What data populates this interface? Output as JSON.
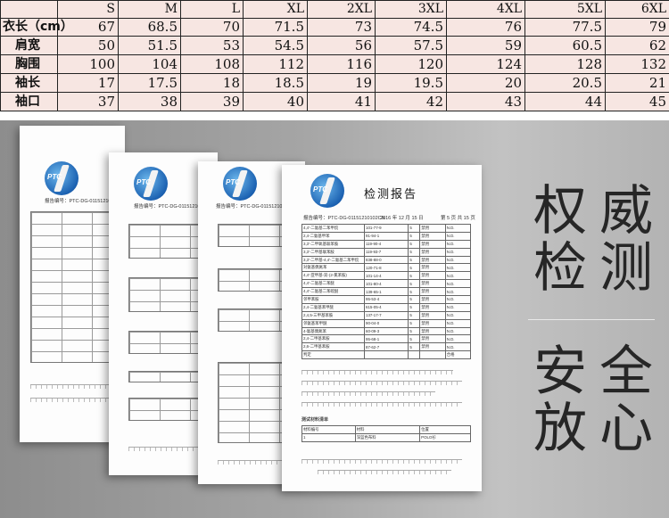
{
  "size_chart": {
    "sizes": [
      "S",
      "M",
      "L",
      "XL",
      "2XL",
      "3XL",
      "4XL",
      "5XL",
      "6XL"
    ],
    "rows": [
      {
        "label": "衣长（cm）",
        "values": [
          "67",
          "68.5",
          "70",
          "71.5",
          "73",
          "74.5",
          "76",
          "77.5",
          "79"
        ]
      },
      {
        "label": "肩宽",
        "values": [
          "50",
          "51.5",
          "53",
          "54.5",
          "56",
          "57.5",
          "59",
          "60.5",
          "62"
        ]
      },
      {
        "label": "胸围",
        "values": [
          "100",
          "104",
          "108",
          "112",
          "116",
          "120",
          "124",
          "128",
          "132"
        ]
      },
      {
        "label": "袖长",
        "values": [
          "17",
          "17.5",
          "18",
          "18.5",
          "19",
          "19.5",
          "20",
          "20.5",
          "21"
        ]
      },
      {
        "label": "袖口",
        "values": [
          "37",
          "38",
          "39",
          "40",
          "41",
          "42",
          "43",
          "44",
          "45"
        ]
      }
    ]
  },
  "banner": {
    "headline_line1": "权威",
    "headline_line2": "检测",
    "tagline_line1": "安全",
    "tagline_line2": "放心",
    "report": {
      "title": "检测报告",
      "report_no_label": "报告编号：",
      "report_no": "PTC-DG-01151210102CN",
      "date": "2016 年 12 月 15 日",
      "page": "第 5 页  共 15 页",
      "logo_text": "PTC"
    },
    "report_rows": [
      [
        "4,4'-二氨基二苯甲烷",
        "101-77-9",
        "5",
        "禁用",
        "N.D."
      ],
      [
        "2,4-二氨基甲苯",
        "91-94-1",
        "5",
        "禁用",
        "N.D."
      ],
      [
        "3,3'-二甲氧基联苯胺",
        "119-90-4",
        "5",
        "禁用",
        "N.D."
      ],
      [
        "3,3'-二甲基联苯胺",
        "119-93-7",
        "5",
        "禁用",
        "N.D."
      ],
      [
        "3,3'-二甲基-4,4'-二氨基二苯甲烷",
        "838-88-0",
        "5",
        "禁用",
        "N.D."
      ],
      [
        "对氨基偶氮苯",
        "120-71-8",
        "5",
        "禁用",
        "N.D."
      ],
      [
        "4,4'-亚甲基-双-(2-氯苯胺)",
        "101-14-4",
        "5",
        "禁用",
        "N.D."
      ],
      [
        "4,4'-二氨基二苯醚",
        "101-80-4",
        "5",
        "禁用",
        "N.D."
      ],
      [
        "4,4'-二氨基二苯硫醚",
        "139-65-1",
        "5",
        "禁用",
        "N.D."
      ],
      [
        "邻甲苯胺",
        "95-53-4",
        "5",
        "禁用",
        "N.D."
      ],
      [
        "2,4-二氨基苯甲醚",
        "615-05-4",
        "5",
        "禁用",
        "N.D."
      ],
      [
        "2,4,5-三甲基苯胺",
        "137-17-7",
        "5",
        "禁用",
        "N.D."
      ],
      [
        "邻氨基苯甲醚",
        "90-04-0",
        "5",
        "禁用",
        "N.D."
      ],
      [
        "4-氨基偶氮苯",
        "60-09-3",
        "5",
        "禁用",
        "N.D."
      ],
      [
        "2,4-二甲基苯胺",
        "95-68-1",
        "5",
        "禁用",
        "N.D."
      ],
      [
        "2,6-二甲基苯胺",
        "87-62-7",
        "5",
        "禁用",
        "N.D."
      ],
      [
        "判定",
        "",
        "",
        "",
        "合格"
      ]
    ],
    "material_table": {
      "heading": "测试材料清单",
      "headers": [
        "材料编号",
        "材料",
        "位置"
      ],
      "row": [
        "1",
        "深蓝色布料",
        "POLO衫"
      ]
    }
  }
}
